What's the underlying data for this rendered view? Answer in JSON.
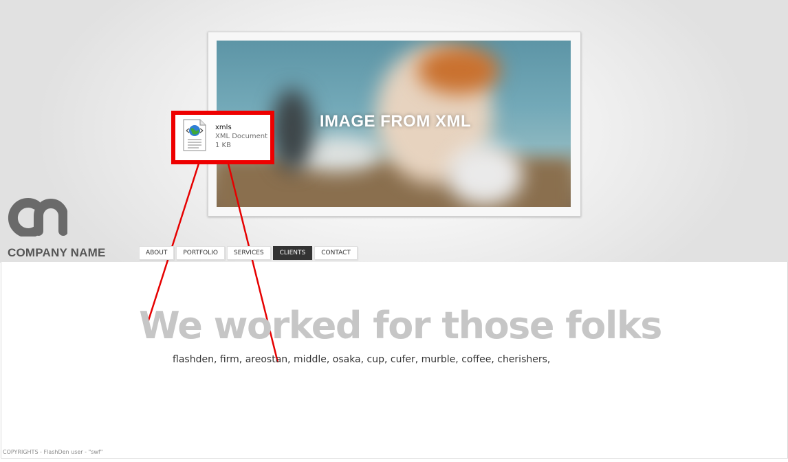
{
  "hero": {
    "caption": "IMAGE FROM XML"
  },
  "callout": {
    "file_name": "xmls",
    "file_type": "XML Document",
    "file_size": "1 KB",
    "icon": "xml-document-icon",
    "border_color": "#ee0000"
  },
  "brand": {
    "company_name": "COMPANY NAME",
    "logo_icon": "company-logo"
  },
  "nav": {
    "items": [
      {
        "label": "ABOUT",
        "active": false
      },
      {
        "label": "PORTFOLIO",
        "active": false
      },
      {
        "label": "SERVICES",
        "active": false
      },
      {
        "label": "CLIENTS",
        "active": true
      },
      {
        "label": "CONTACT",
        "active": false
      }
    ]
  },
  "clients": {
    "headline": "We worked for those folks",
    "list": "flashden, firm, areostan, middle, osaka, cup, cufer, murble, coffee, cherishers,"
  },
  "footer": {
    "copyright": "COPYRIGHTS - FlashDen user - \"swf\""
  },
  "colors": {
    "accent_red": "#ee0000",
    "nav_active_bg": "#333333",
    "headline": "#c6c6c6"
  }
}
